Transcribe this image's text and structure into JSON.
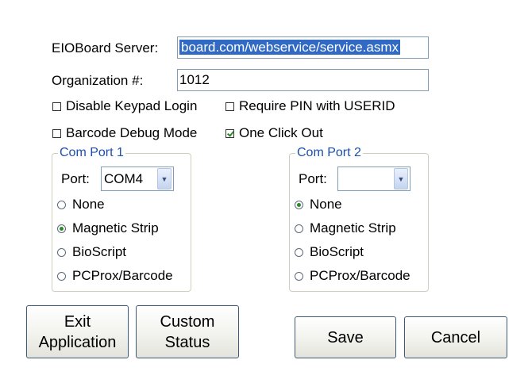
{
  "server": {
    "label": "EIOBoard Server:",
    "value": "board.com/webservice/service.asmx"
  },
  "organization": {
    "label": "Organization #:",
    "value": "1012"
  },
  "options": {
    "disable_keypad_login": {
      "label": "Disable Keypad Login",
      "checked": false
    },
    "require_pin": {
      "label": "Require PIN with USERID",
      "checked": false
    },
    "barcode_debug": {
      "label": "Barcode Debug Mode",
      "checked": false
    },
    "one_click_out": {
      "label": "One Click Out",
      "checked": true
    }
  },
  "com1": {
    "title": "Com Port 1",
    "port_label": "Port:",
    "port_value": "COM4",
    "radios": [
      "None",
      "Magnetic Strip",
      "BioScript",
      "PCProx/Barcode"
    ],
    "selected": "Magnetic Strip"
  },
  "com2": {
    "title": "Com Port 2",
    "port_label": "Port:",
    "port_value": "",
    "radios": [
      "None",
      "Magnetic Strip",
      "BioScript",
      "PCProx/Barcode"
    ],
    "selected": "None"
  },
  "buttons": {
    "exit_line1": "Exit",
    "exit_line2": "Application",
    "custom_line1": "Custom",
    "custom_line2": "Status",
    "save": "Save",
    "cancel": "Cancel"
  },
  "colors": {
    "legend": "#1c4fb0",
    "selection": "#316ac5",
    "check": "#2a8a2a"
  }
}
